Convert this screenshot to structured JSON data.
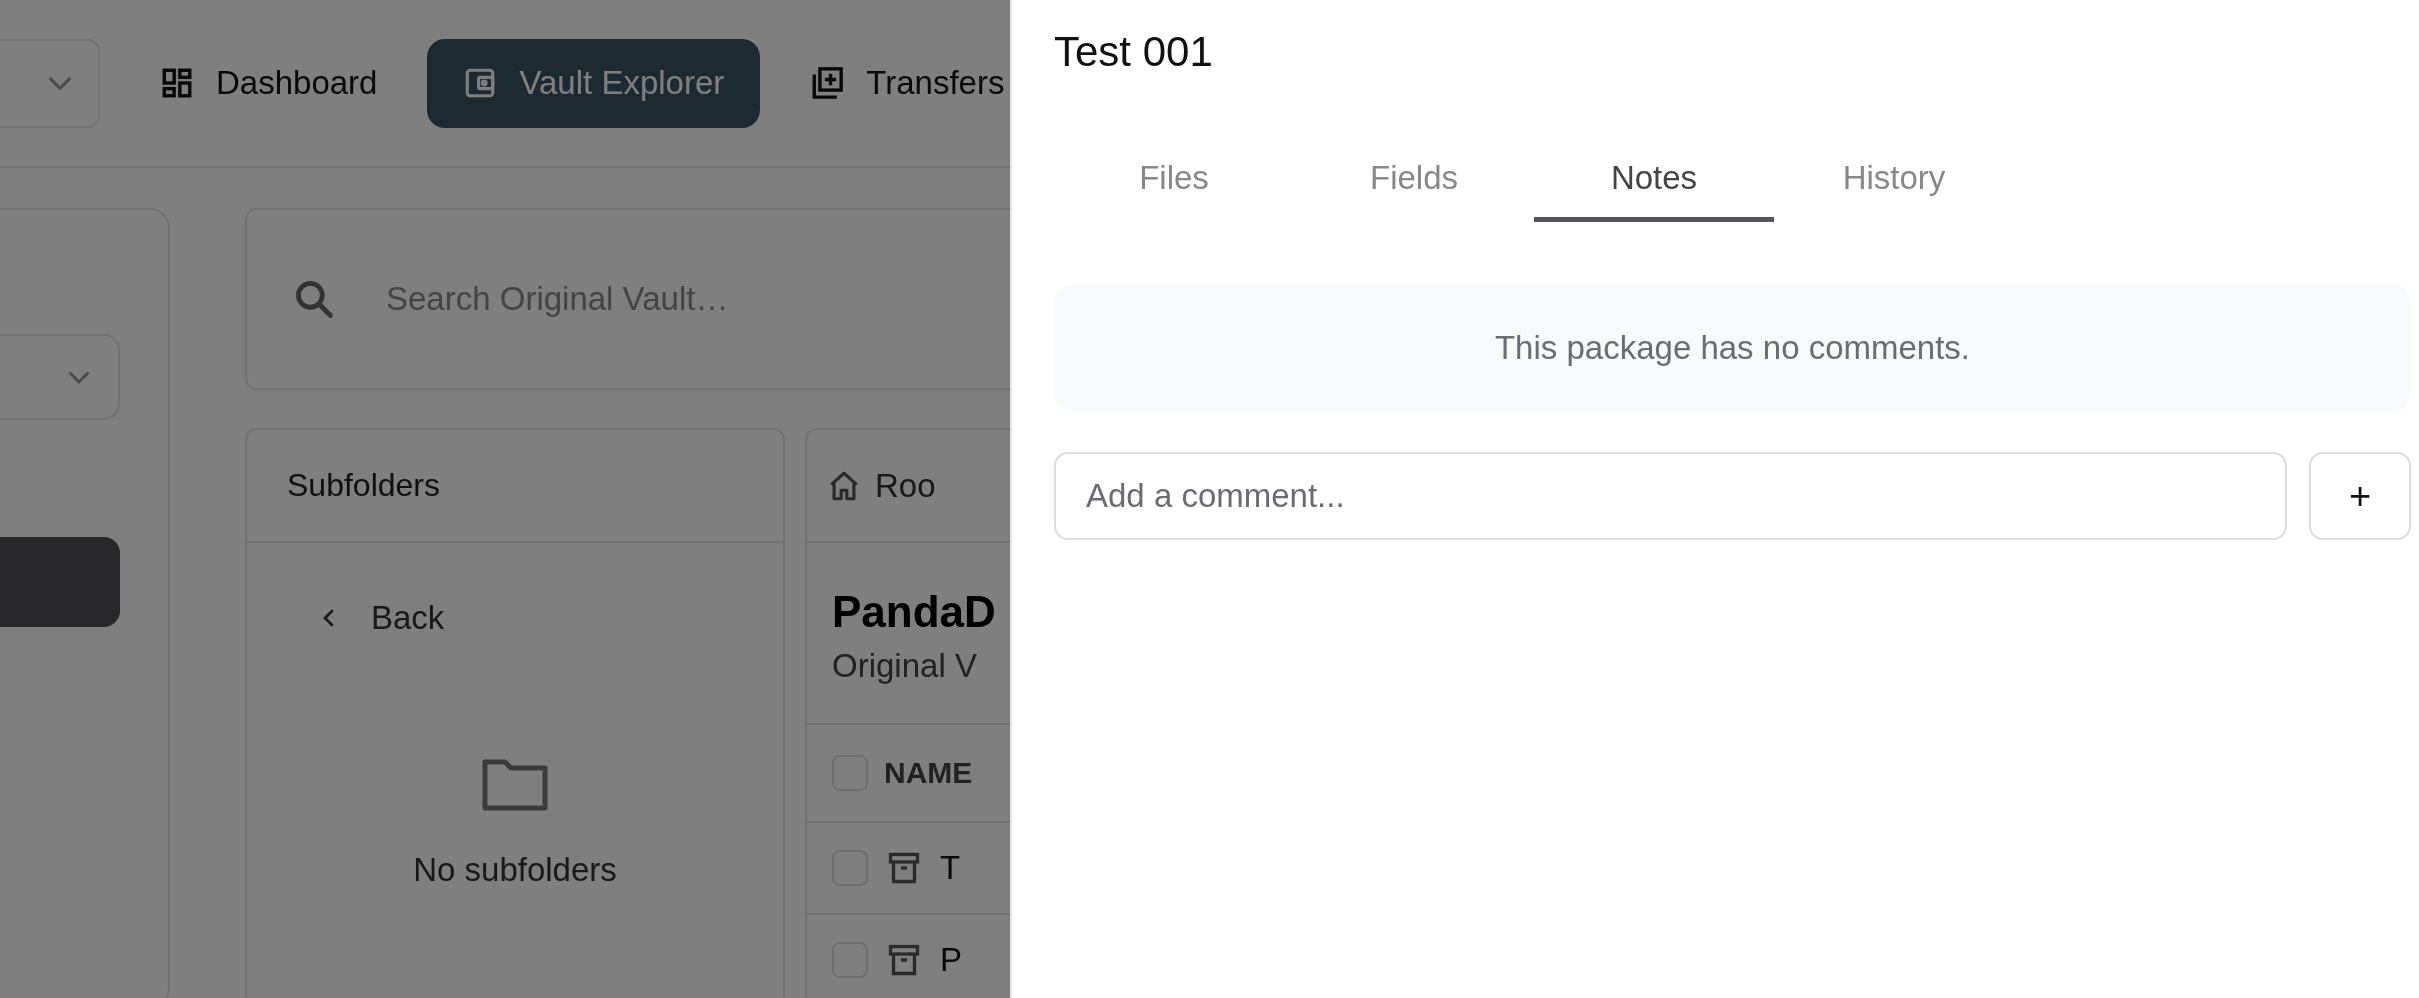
{
  "background_page": {
    "nav": [
      {
        "label": "Dashboard",
        "selected": false
      },
      {
        "label": "Vault Explorer",
        "selected": true
      },
      {
        "label": "Transfers",
        "selected": false
      }
    ],
    "search": {
      "placeholder": "Search Original Vault…"
    },
    "subfolders": {
      "title": "Subfolders",
      "back": "Back",
      "empty_message": "No subfolders"
    },
    "content": {
      "breadcrumb": "Roo",
      "title": "PandaD",
      "subtitle": "Original V",
      "columns": [
        "NAME"
      ],
      "all_checked": false,
      "rows": [
        {
          "name": "T",
          "checked": false
        },
        {
          "name": "P",
          "checked": false
        }
      ]
    }
  },
  "drawer": {
    "title": "Test 001",
    "tabs": [
      {
        "label": "Files",
        "selected": false
      },
      {
        "label": "Fields",
        "selected": false
      },
      {
        "label": "Notes",
        "selected": true
      },
      {
        "label": "History",
        "selected": false
      }
    ],
    "empty_message": "This package has no comments.",
    "comment_field": {
      "placeholder": "Add a comment..."
    },
    "add_button": "+"
  }
}
